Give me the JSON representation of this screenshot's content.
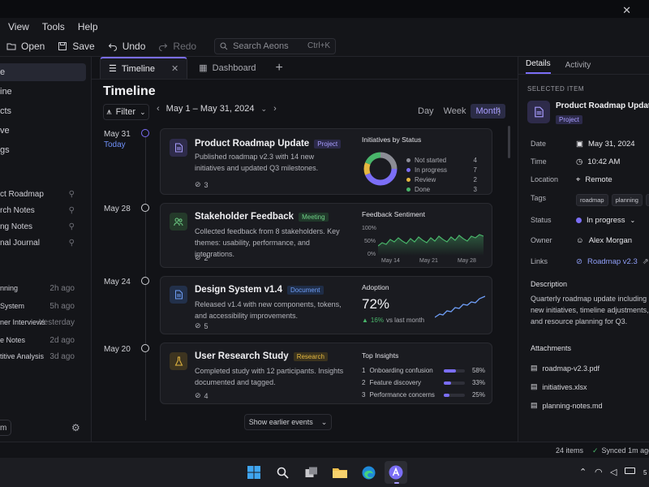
{
  "menu": {
    "items": [
      "View",
      "Tools",
      "Help"
    ]
  },
  "toolbar": {
    "open": "Open",
    "save": "Save",
    "undo": "Undo",
    "redo": "Redo",
    "search_placeholder": "Search Aeons",
    "search_shortcut": "Ctrl+K"
  },
  "sidebar": {
    "nav": [
      {
        "label": "e",
        "active": true
      },
      {
        "label": "ine"
      },
      {
        "label": "cts"
      },
      {
        "label": "ve"
      },
      {
        "label": "gs"
      }
    ],
    "pinned": [
      {
        "label": "ct Roadmap"
      },
      {
        "label": "rch Notes"
      },
      {
        "label": "ng Notes"
      },
      {
        "label": "nal Journal"
      }
    ],
    "recent": [
      {
        "label": "nning",
        "time": "2h ago"
      },
      {
        "label": "System",
        "time": "5h ago"
      },
      {
        "label": "ner Interviews",
        "time": "Yesterday"
      },
      {
        "label": "e Notes",
        "time": "2d ago"
      },
      {
        "label": "titive Analysis",
        "time": "3d ago"
      }
    ],
    "bottom_btn": "m"
  },
  "tabs": [
    {
      "label": "Timeline",
      "active": true
    },
    {
      "label": "Dashboard"
    }
  ],
  "main": {
    "title": "Timeline",
    "filter": "Filter",
    "date_range": "May 1 – May 31, 2024",
    "views": [
      "Day",
      "Week",
      "Month"
    ],
    "active_view": "Month",
    "show_earlier": "Show earlier events"
  },
  "timeline": [
    {
      "date": "May 31",
      "sub": "Today"
    },
    {
      "date": "May 28"
    },
    {
      "date": "May 24"
    },
    {
      "date": "May 20"
    }
  ],
  "cards": [
    {
      "title": "Product Roadmap Update",
      "badge": "Project",
      "desc": "Published roadmap v2.3 with 14 new initiatives and updated Q3 milestones.",
      "attachments": "3",
      "right_title": "Initiatives by Status",
      "legend": [
        {
          "label": "Not started",
          "value": "4",
          "color": "#8b8c95"
        },
        {
          "label": "In progress",
          "value": "7",
          "color": "#7b6ef6"
        },
        {
          "label": "Review",
          "value": "2",
          "color": "#e5b840"
        },
        {
          "label": "Done",
          "value": "3",
          "color": "#49b56a"
        }
      ]
    },
    {
      "title": "Stakeholder Feedback",
      "badge": "Meeting",
      "desc": "Collected feedback from 8 stakeholders. Key themes: usability, performance, and integrations.",
      "attachments": "2",
      "right_title": "Feedback Sentiment",
      "y_ticks": [
        "100%",
        "50%",
        "0%"
      ],
      "x_ticks": [
        "May 14",
        "May 21",
        "May 28"
      ]
    },
    {
      "title": "Design System v1.4",
      "badge": "Document",
      "desc": "Released v1.4 with new components, tokens, and accessibility improvements.",
      "attachments": "5",
      "right_title": "Adoption",
      "big_value": "72%",
      "delta": "16%",
      "delta_label": "vs last month"
    },
    {
      "title": "User Research Study",
      "badge": "Research",
      "desc": "Completed study with 12 participants. Insights documented and tagged.",
      "attachments": "4",
      "right_title": "Top Insights",
      "insights": [
        {
          "n": "1",
          "label": "Onboarding confusion",
          "pct": "58%",
          "value": 0.58
        },
        {
          "n": "2",
          "label": "Feature discovery",
          "pct": "33%",
          "value": 0.33
        },
        {
          "n": "3",
          "label": "Performance concerns",
          "pct": "25%",
          "value": 0.25
        }
      ]
    }
  ],
  "details": {
    "tabs": [
      "Details",
      "Activity"
    ],
    "selected_label": "SELECTED ITEM",
    "selected_title": "Product Roadmap Update",
    "selected_badge": "Project",
    "fields": {
      "date_label": "Date",
      "date": "May 31, 2024",
      "time_label": "Time",
      "time": "10:42 AM",
      "location_label": "Location",
      "location": "Remote",
      "tags_label": "Tags",
      "tags": [
        "roadmap",
        "planning",
        "q"
      ],
      "status_label": "Status",
      "status": "In progress",
      "owner_label": "Owner",
      "owner": "Alex Morgan",
      "links_label": "Links",
      "link": "Roadmap v2.3"
    },
    "description_label": "Description",
    "description": "Quarterly roadmap update including new initiatives, timeline adjustments, and resource planning for Q3.",
    "attachments_label": "Attachments",
    "attachments": [
      "roadmap-v2.3.pdf",
      "initiatives.xlsx",
      "planning-notes.md"
    ]
  },
  "status": {
    "items": "24 items",
    "synced": "Synced 1m ago"
  },
  "taskbar": {
    "clock": "5"
  }
}
